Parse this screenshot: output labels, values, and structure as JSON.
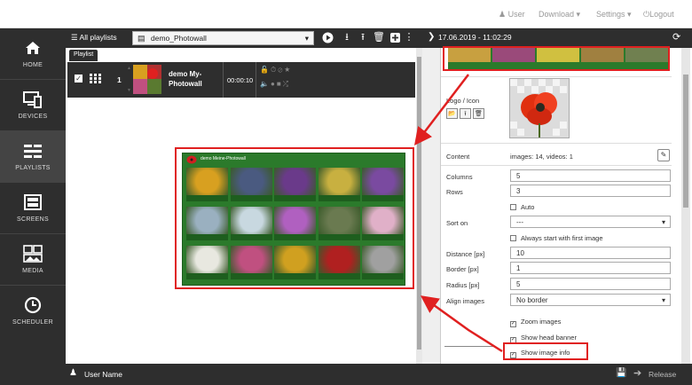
{
  "header": {
    "user_label": "User",
    "download_label": "Download",
    "settings_label": "Settings",
    "logout_label": "Logout"
  },
  "sidebar": {
    "items": [
      {
        "label": "HOME",
        "icon": "home-icon"
      },
      {
        "label": "DEVICES",
        "icon": "devices-icon"
      },
      {
        "label": "PLAYLISTS",
        "icon": "playlists-icon"
      },
      {
        "label": "SCREENS",
        "icon": "screens-icon"
      },
      {
        "label": "MEDIA",
        "icon": "media-icon"
      },
      {
        "label": "SCHEDULER",
        "icon": "clock-icon"
      }
    ],
    "active_index": 2
  },
  "toolbar": {
    "all_playlists_label": "All playlists",
    "selected_playlist": "demo_Photowall",
    "datetime": "17.06.2019 - 11:02:29"
  },
  "playlist": {
    "tab_label": "Playlist",
    "row": {
      "index": "1",
      "title_line1": "demo My-",
      "title_line2": "Photowall",
      "duration": "00:00:10"
    }
  },
  "preview": {
    "title": "demo Meine-Photowall",
    "colors": [
      "#d8a020",
      "#4a5a80",
      "#6a3a8a",
      "#c8b040",
      "#7a4aa0",
      "#9ab0c0",
      "#c8d8e0",
      "#b060c0",
      "#6a7a50",
      "#e0b0c8",
      "#e8e8e0",
      "#c05080",
      "#d0a020",
      "#b02020",
      "#a0a0a0"
    ]
  },
  "properties": {
    "logo_label": "Logo / Icon",
    "content_label": "Content",
    "content_value": "images: 14, videos: 1",
    "columns_label": "Columns",
    "columns_value": "5",
    "rows_label": "Rows",
    "rows_value": "3",
    "auto_label": "Auto",
    "sort_label": "Sort on",
    "sort_value": "---",
    "always_start_label": "Always start with first image",
    "distance_label": "Distance [px]",
    "distance_value": "10",
    "border_label": "Border [px]",
    "border_value": "1",
    "radius_label": "Radius [px]",
    "radius_value": "5",
    "align_label": "Align images",
    "align_value": "No border",
    "zoom_label": "Zoom images",
    "head_banner_label": "Show head banner",
    "image_info_label": "Show image info"
  },
  "footer": {
    "user_name": "User Name",
    "release_label": "Release"
  },
  "accent": "#e02020"
}
